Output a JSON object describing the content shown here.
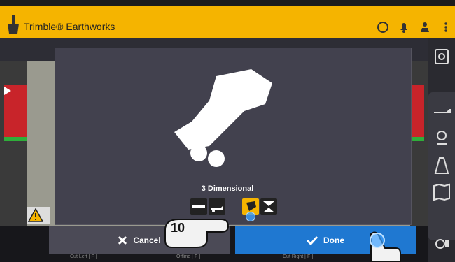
{
  "app": {
    "title": "Trimble® Earthworks",
    "brand_color": "#f5b400"
  },
  "top_icons": [
    "cloud-status-icon",
    "notification-bell-icon",
    "operator-icon",
    "more-menu-icon"
  ],
  "info_row": {
    "design_label": "",
    "cut_left_value": "",
    "cut_right_value": ""
  },
  "modal": {
    "mode_label": "3 Dimensional",
    "mode_buttons": [
      "blade-mode-icon",
      "machine-side-icon",
      "machine-3d-icon",
      "vertical-align-icon"
    ]
  },
  "buttons": {
    "cancel_label": "Cancel",
    "done_label": "Done",
    "accent_done": "#1f78d1"
  },
  "footer_labels": {
    "left": "Cut Left [ F ]",
    "center": "Offline [ F ]",
    "right": "Cut Right [ F ]"
  },
  "annotation": {
    "step_number": "10"
  },
  "right_sidebar": [
    "settings-icon",
    "machine-icon",
    "location-icon",
    "road-icon",
    "map-icon",
    "machine-settings-icon"
  ]
}
